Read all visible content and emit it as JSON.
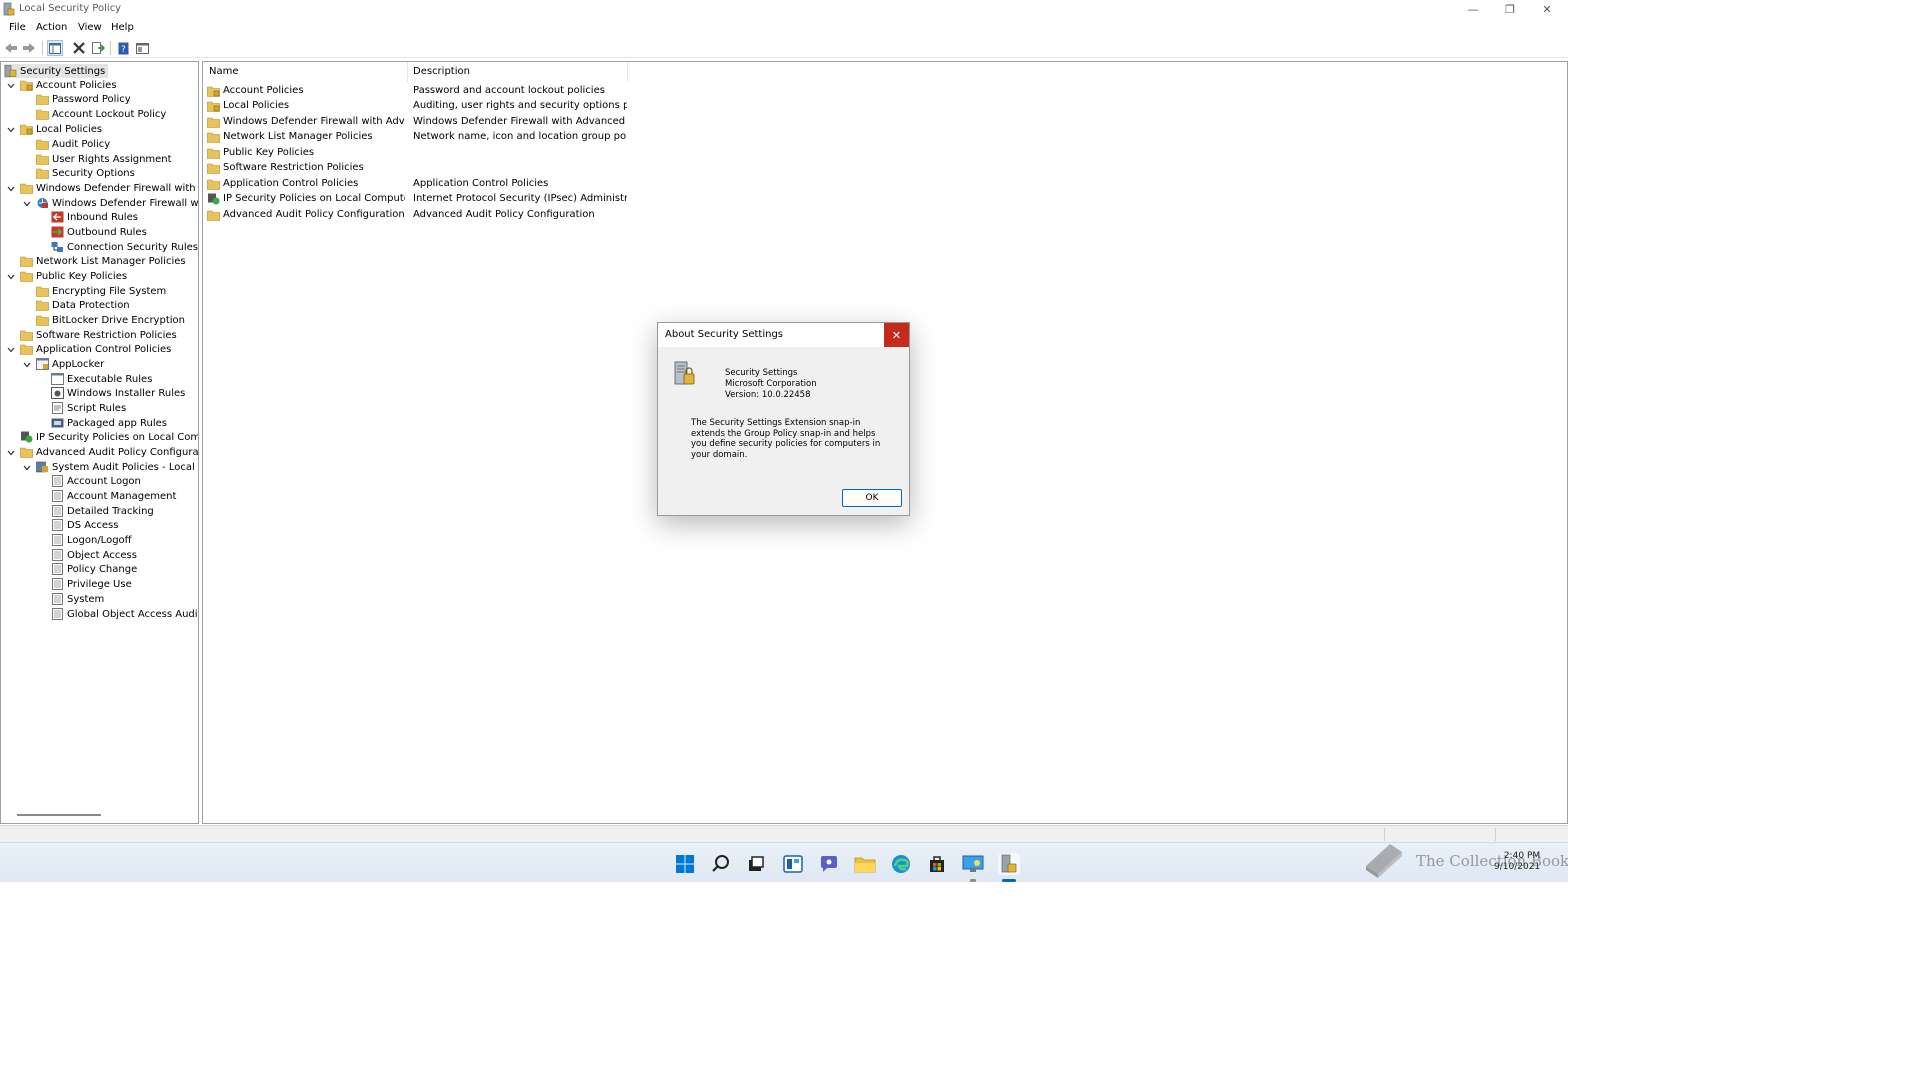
{
  "window": {
    "title": "Local Security Policy",
    "minimize_glyph": "—",
    "restore_glyph": "❐",
    "close_glyph": "✕"
  },
  "menubar": {
    "file": "File",
    "action": "Action",
    "view": "View",
    "help": "Help"
  },
  "toolbar": {
    "icons": [
      "back-icon",
      "forward-icon",
      "show-hide-tree-icon",
      "delete-icon",
      "export-list-icon",
      "help-icon",
      "properties-icon"
    ]
  },
  "tree": {
    "root": "Security Settings",
    "account_policies": "Account Policies",
    "password_policy": "Password Policy",
    "account_lockout_policy": "Account Lockout Policy",
    "local_policies": "Local Policies",
    "audit_policy": "Audit Policy",
    "user_rights_assignment": "User Rights Assignment",
    "security_options": "Security Options",
    "wdf_outer": "Windows Defender Firewall with Adva",
    "wdf_inner": "Windows Defender Firewall with A",
    "inbound_rules": "Inbound Rules",
    "outbound_rules": "Outbound Rules",
    "connection_security_rules": "Connection Security Rules",
    "network_list_manager": "Network List Manager Policies",
    "public_key_policies": "Public Key Policies",
    "encrypting_file_system": "Encrypting File System",
    "data_protection": "Data Protection",
    "bitlocker": "BitLocker Drive Encryption",
    "software_restriction": "Software Restriction Policies",
    "application_control": "Application Control Policies",
    "applocker": "AppLocker",
    "executable_rules": "Executable Rules",
    "windows_installer_rules": "Windows Installer Rules",
    "script_rules": "Script Rules",
    "packaged_app_rules": "Packaged app Rules",
    "ip_security": "IP Security Policies on Local Compute",
    "advanced_audit": "Advanced Audit Policy Configuration",
    "system_audit": "System Audit Policies - Local Grou",
    "account_logon": "Account Logon",
    "account_management": "Account Management",
    "detailed_tracking": "Detailed Tracking",
    "ds_access": "DS Access",
    "logon_logoff": "Logon/Logoff",
    "object_access": "Object Access",
    "policy_change": "Policy Change",
    "privilege_use": "Privilege Use",
    "system": "System",
    "global_object_access": "Global Object Access Auditing"
  },
  "list": {
    "columns": {
      "name": "Name",
      "description": "Description"
    },
    "rows": [
      {
        "name": "Account Policies",
        "description": "Password and account lockout policies"
      },
      {
        "name": "Local Policies",
        "description": "Auditing, user rights and security options polici..."
      },
      {
        "name": "Windows Defender Firewall with Advanc...",
        "description": "Windows Defender Firewall with Advanced Sec..."
      },
      {
        "name": "Network List Manager Policies",
        "description": "Network name, icon and location group policies."
      },
      {
        "name": "Public Key Policies",
        "description": ""
      },
      {
        "name": "Software Restriction Policies",
        "description": ""
      },
      {
        "name": "Application Control Policies",
        "description": "Application Control Policies"
      },
      {
        "name": "IP Security Policies on Local Computer",
        "description": "Internet Protocol Security (IPsec) Administratio..."
      },
      {
        "name": "Advanced Audit Policy Configuration",
        "description": "Advanced Audit Policy Configuration"
      }
    ]
  },
  "dialog": {
    "title": "About Security Settings",
    "close_glyph": "✕",
    "product": "Security Settings",
    "company": "Microsoft Corporation",
    "version": "Version: 10.0.22458",
    "description": "The Security Settings Extension snap-in extends the Group Policy snap-in and helps you define security policies for computers in your domain.",
    "ok_label": "OK"
  },
  "taskbar": {
    "icons": [
      "start-icon",
      "search-icon",
      "task-view-icon",
      "widgets-icon",
      "chat-icon",
      "file-explorer-icon",
      "edge-icon",
      "store-icon",
      "control-panel-icon",
      "local-security-policy-icon"
    ],
    "time": "2:40 PM",
    "date": "9/10/2021"
  },
  "watermark": {
    "text": "The Collection Book"
  },
  "colors": {
    "accent": "#0067c0",
    "close_red": "#c42b1c",
    "folder": "#e8c35a"
  }
}
